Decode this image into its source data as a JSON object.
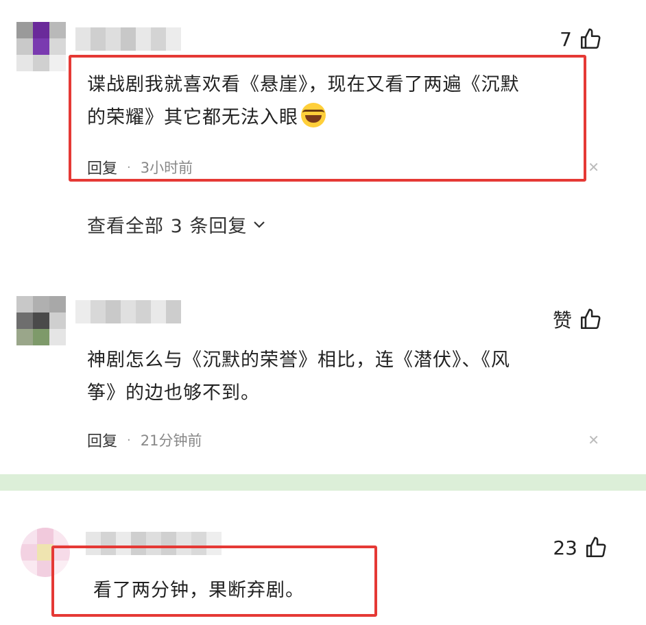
{
  "comments": [
    {
      "likes": "7",
      "text_line1": "谍战剧我就喜欢看《悬崖》，现在又看了两遍《沉默",
      "text_line2": "的荣耀》其它都无法入眼",
      "emoji": "laughing-tears-emoji",
      "reply_label": "回复",
      "time": "3小时前",
      "view_replies": "查看全部 3 条回复"
    },
    {
      "likes": "赞",
      "text_line1": "神剧怎么与《沉默的荣誉》相比，连《潜伏》、《风",
      "text_line2": "筝》的边也够不到。",
      "reply_label": "回复",
      "time": "21分钟前"
    },
    {
      "likes": "23",
      "text_line1": "看了两分钟，果断弃剧。"
    }
  ],
  "colors": {
    "highlight_box": "#e53935",
    "divider": "#dcefd8"
  },
  "icons": {
    "like": "thumbs-up-icon",
    "close": "close-icon",
    "expand": "chevron-down-icon"
  }
}
